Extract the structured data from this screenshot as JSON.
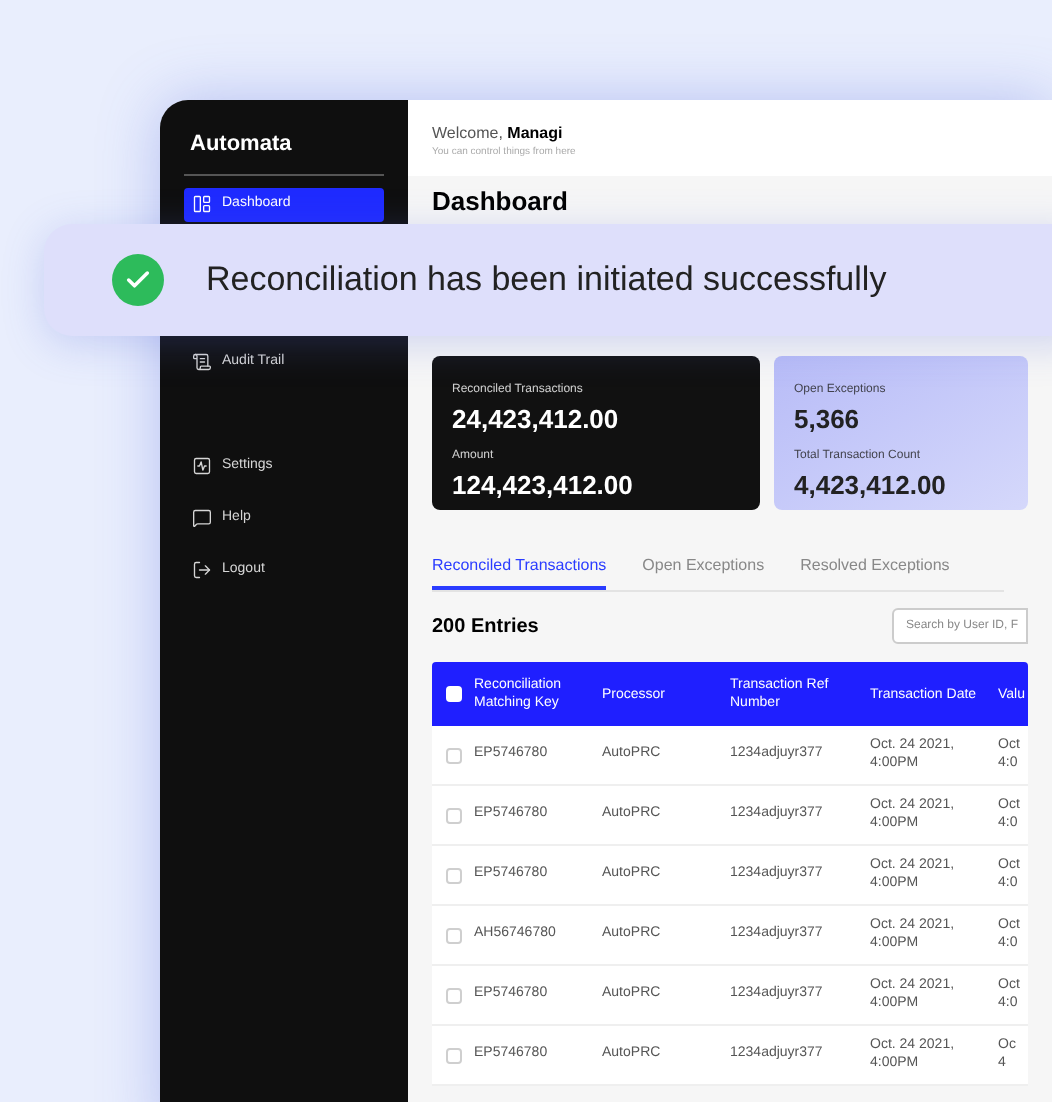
{
  "sidebar": {
    "title": "Automata",
    "items": [
      {
        "label": "Dashboard",
        "selected": true
      },
      {
        "label": "Audit Trail",
        "selected": false
      }
    ],
    "bottom_items": [
      {
        "label": "Settings",
        "selected": false
      },
      {
        "label": "Help",
        "selected": false
      },
      {
        "label": "Logout",
        "selected": false
      }
    ]
  },
  "header": {
    "greeting": "Welcome,",
    "user": "Managi",
    "subtitle": "You can control things from here"
  },
  "page_title": "Dashboard",
  "toast": {
    "message": "Reconciliation has been initiated successfully"
  },
  "stats": [
    {
      "kind": "dark",
      "label": "Reconciled Transactions",
      "value": "24,423,412.00",
      "label_2": "Amount",
      "value_2": "124,423,412.00"
    },
    {
      "kind": "light",
      "label": "Open Exceptions",
      "value": "5,366",
      "label_2": "Total Transaction Count",
      "value_2": "4,423,412.00"
    }
  ],
  "tabs": [
    {
      "label": "Reconciled Transactions",
      "selected": true
    },
    {
      "label": "Open Exceptions",
      "selected": false
    },
    {
      "label": "Resolved Exceptions",
      "selected": false
    }
  ],
  "entries": "200 Entries",
  "search": {
    "placeholder": "Search by User ID, F"
  },
  "table": {
    "select_all_checked": false,
    "columns": [
      "Reconciliation Matching Key",
      "Processor",
      "Transaction Ref Number",
      "Transaction Date",
      "Valu"
    ],
    "rows": [
      {
        "checked": false,
        "cells": [
          "EP5746780",
          "AutoPRC",
          "1234adjuyr377",
          "Oct. 24 2021, 4:00PM",
          "Oct 4:0"
        ]
      },
      {
        "checked": false,
        "cells": [
          "EP5746780",
          "AutoPRC",
          "1234adjuyr377",
          "Oct. 24 2021, 4:00PM",
          "Oct 4:0"
        ]
      },
      {
        "checked": false,
        "cells": [
          "EP5746780",
          "AutoPRC",
          "1234adjuyr377",
          "Oct. 24 2021, 4:00PM",
          "Oct 4:0"
        ]
      },
      {
        "checked": false,
        "cells": [
          "AH56746780",
          "AutoPRC",
          "1234adjuyr377",
          "Oct. 24 2021, 4:00PM",
          "Oct 4:0"
        ]
      },
      {
        "checked": false,
        "cells": [
          "EP5746780",
          "AutoPRC",
          "1234adjuyr377",
          "Oct. 24 2021, 4:00PM",
          "Oct 4:0"
        ]
      },
      {
        "checked": false,
        "cells": [
          "EP5746780",
          "AutoPRC",
          "1234adjuyr377",
          "Oct. 24 2021, 4:00PM",
          "Oc 4"
        ]
      }
    ]
  }
}
